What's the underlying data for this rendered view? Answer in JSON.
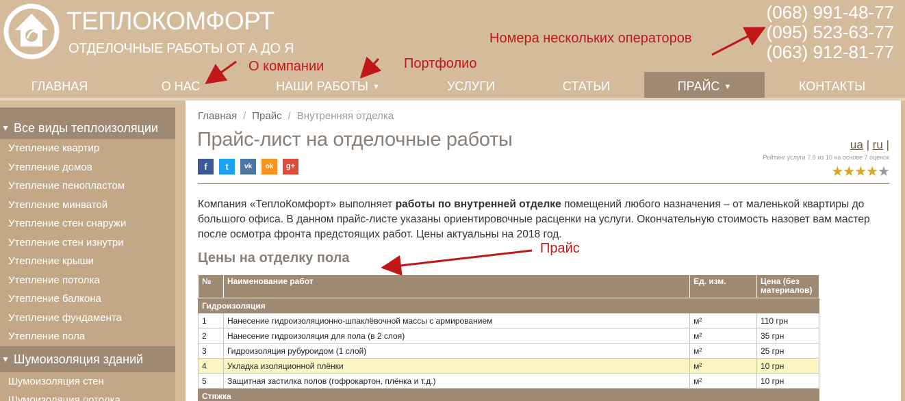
{
  "header": {
    "logo_title": "ТЕПЛОКОМФОРТ",
    "logo_subtitle": "ОТДЕЛОЧНЫЕ РАБОТЫ ОТ А ДО Я",
    "phones": [
      "(068) 991-48-77",
      "(095) 523-63-77",
      "(063) 912-81-77"
    ]
  },
  "annotations": {
    "operators": "Номера нескольких операторов",
    "about": "О компании",
    "portfolio": "Портфолио",
    "price": "Прайс",
    "color": "#c01818"
  },
  "nav": {
    "items": [
      {
        "label": "ГЛАВНАЯ"
      },
      {
        "label": "О НАС"
      },
      {
        "label": "НАШИ РАБОТЫ",
        "caret": "▼"
      },
      {
        "label": "УСЛУГИ"
      },
      {
        "label": "СТАТЬИ"
      },
      {
        "label": "ПРАЙС",
        "caret": "▼",
        "active": true
      },
      {
        "label": "КОНТАКТЫ"
      }
    ]
  },
  "sidebar": {
    "group1": {
      "title": "Все виды теплоизоляции",
      "items": [
        "Утепление квартир",
        "Утепление домов",
        "Утепление пенопластом",
        "Утепление минватой",
        "Утепление стен снаружи",
        "Утепление стен изнутри",
        "Утепление крыши",
        "Утепление потолка",
        "Утепление балкона",
        "Утепление фундамента",
        "Утепление пола"
      ]
    },
    "group2": {
      "title": "Шумоизоляция зданий",
      "items": [
        "Шумоизоляция стен",
        "Шумоизоляция потолка"
      ]
    }
  },
  "breadcrumb": [
    "Главная",
    "Прайс",
    "Внутренняя отделка"
  ],
  "page_title": "Прайс-лист на отделочные работы",
  "social": [
    {
      "icon": "facebook-icon",
      "glyph": "f",
      "color": "#3b5998"
    },
    {
      "icon": "twitter-icon",
      "glyph": "t",
      "color": "#1da1f2"
    },
    {
      "icon": "vk-icon",
      "glyph": "vk",
      "color": "#4c75a3"
    },
    {
      "icon": "odnoklassniki-icon",
      "glyph": "ok",
      "color": "#f7931e"
    },
    {
      "icon": "google-plus-icon",
      "glyph": "g+",
      "color": "#dd4b39"
    }
  ],
  "lang": {
    "ua": "ua",
    "ru": "ru",
    "sep": "|"
  },
  "rating": {
    "text": "Рейтинг услуги 7.9 из 10 на основе 7 оценок",
    "stars_on": 4,
    "stars_total": 5
  },
  "intro": {
    "part1": "Компания «ТеплоКомфорт» выполняет ",
    "bold": "работы по внутренней отделке",
    "part2": " помещений любого назначения – от маленькой квартиры до большого офиса. В данном прайс-листе указаны ориентировочные расценки на услуги. Окончательную стоимость назовет вам мастер после осмотра фронта предстоящих работ. Цены актуальны на 2018 год."
  },
  "section_title": "Цены на отделку пола",
  "table": {
    "headers": [
      "№",
      "Наименование работ",
      "Ед. изм.",
      "Цена (без материалов)"
    ],
    "groups": [
      {
        "name": "Гидроизоляция",
        "rows": [
          {
            "n": "1",
            "name": "Нанесение гидроизоляционно-шпаклёвочной массы с армированием",
            "unit": "м²",
            "price": "110 грн"
          },
          {
            "n": "2",
            "name": "Нанесение гидроизоляция для пола (в 2 слоя)",
            "unit": "м²",
            "price": "35 грн"
          },
          {
            "n": "3",
            "name": "Гидроизоляция рубуроидом (1 слой)",
            "unit": "м²",
            "price": "25 грн"
          },
          {
            "n": "4",
            "name": "Укладка изоляционной плёнки",
            "unit": "м²",
            "price": "10 грн",
            "highlight": true
          },
          {
            "n": "5",
            "name": "Защитная застилка полов (гофрокартон, плёнка и т.д.)",
            "unit": "м²",
            "price": "10 грн"
          }
        ]
      },
      {
        "name": "Стяжка",
        "rows": []
      }
    ]
  }
}
